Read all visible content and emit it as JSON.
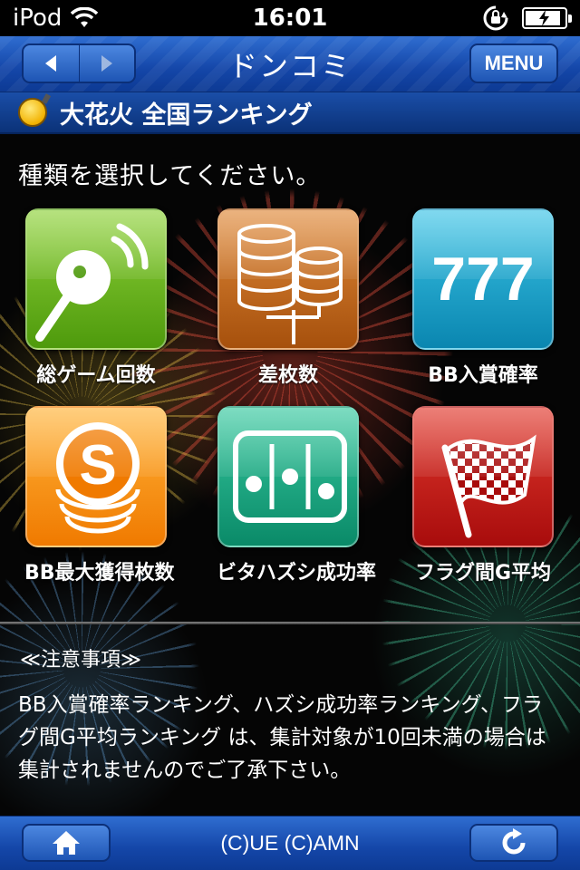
{
  "status_bar": {
    "carrier": "iPod",
    "time": "16:01",
    "battery_level": 0.9
  },
  "nav": {
    "title": "ドンコミ",
    "menu_label": "MENU"
  },
  "section": {
    "title": "大花火 全国ランキング"
  },
  "main": {
    "prompt": "種類を選択してください。",
    "tiles": [
      {
        "label": "総ゲーム回数",
        "icon": "lever-icon"
      },
      {
        "label": "差枚数",
        "icon": "coin-stacks-icon"
      },
      {
        "label": "BB入賞確率",
        "icon_text": "777"
      },
      {
        "label": "BB最大獲得枚数",
        "icon": "s-coin-icon"
      },
      {
        "label": "ビタハズシ成功率",
        "icon": "reels-icon"
      },
      {
        "label": "フラグ間G平均",
        "icon": "checkered-flag-icon"
      }
    ],
    "notice_title": "≪注意事項≫",
    "notice_body": "BB入賞確率ランキング、ハズシ成功率ランキング、フラグ間G平均ランキング は、集計対象が10回未満の場合は集計されませんのでご了承下さい。"
  },
  "bottom": {
    "copyright": "(C)UE (C)AMN"
  },
  "colors": {
    "nav_blue": "#1446a8",
    "tile_green": "#6ab820",
    "tile_brown": "#c46a20",
    "tile_cyan": "#20a6cc",
    "tile_orange": "#f8981a",
    "tile_teal": "#20a884",
    "tile_red": "#c41e1e"
  }
}
